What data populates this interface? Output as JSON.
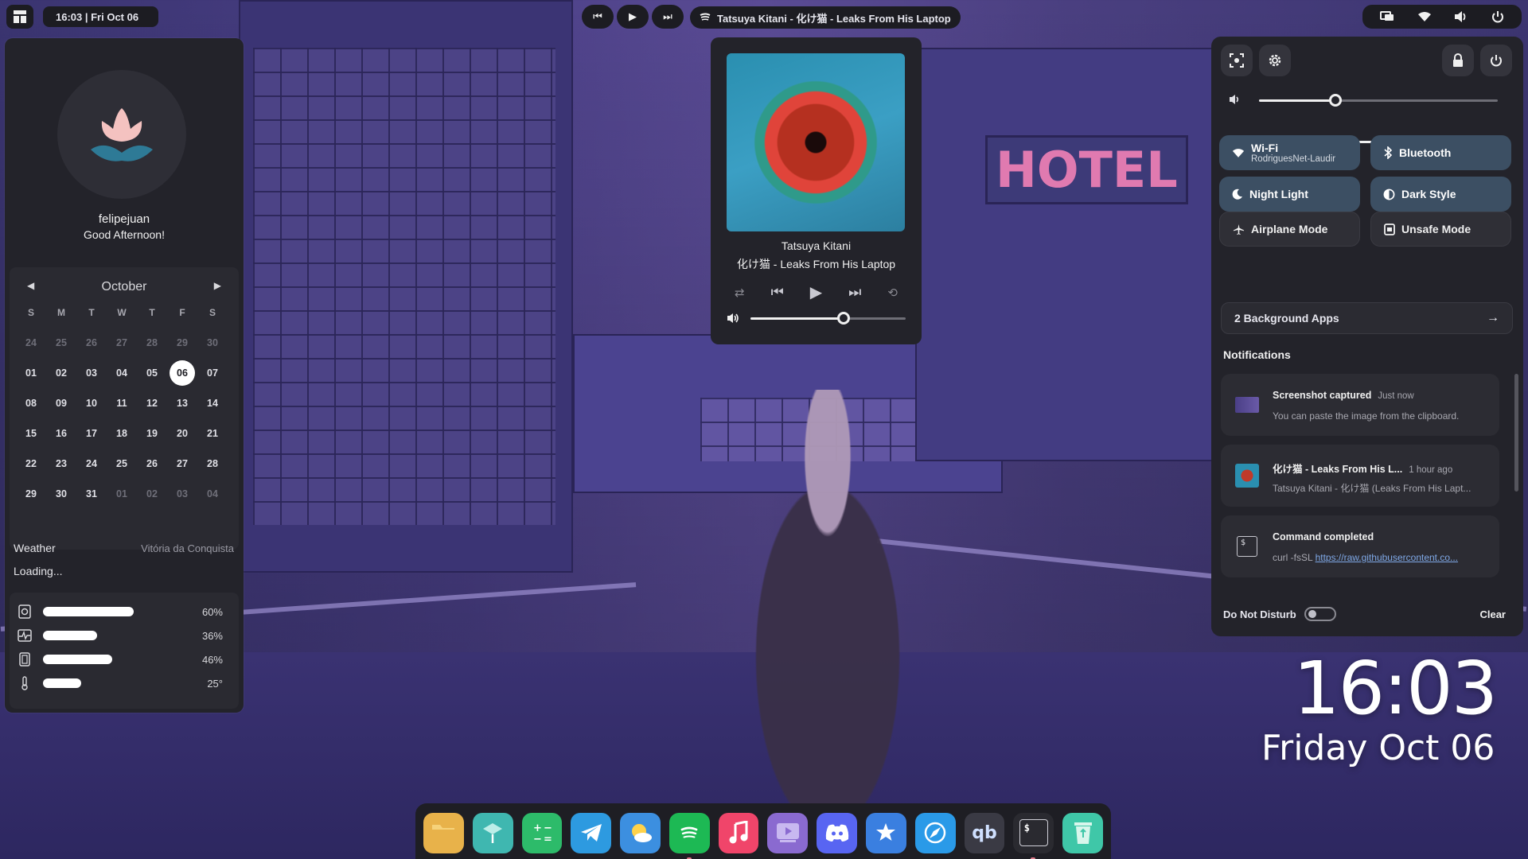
{
  "topbar": {
    "clock": "16:03 | Fri Oct 06",
    "now_playing": "Tatsuya Kitani - 化け猫 - Leaks From His Laptop"
  },
  "dashboard": {
    "username": "felipejuan",
    "greeting": "Good Afternoon!",
    "calendar": {
      "month": "October",
      "weekdays": [
        "S",
        "M",
        "T",
        "W",
        "T",
        "F",
        "S"
      ],
      "days": [
        {
          "d": "24",
          "dim": true
        },
        {
          "d": "25",
          "dim": true
        },
        {
          "d": "26",
          "dim": true
        },
        {
          "d": "27",
          "dim": true
        },
        {
          "d": "28",
          "dim": true
        },
        {
          "d": "29",
          "dim": true
        },
        {
          "d": "30",
          "dim": true
        },
        {
          "d": "01"
        },
        {
          "d": "02"
        },
        {
          "d": "03"
        },
        {
          "d": "04"
        },
        {
          "d": "05"
        },
        {
          "d": "06",
          "today": true
        },
        {
          "d": "07"
        },
        {
          "d": "08"
        },
        {
          "d": "09"
        },
        {
          "d": "10"
        },
        {
          "d": "11"
        },
        {
          "d": "12"
        },
        {
          "d": "13"
        },
        {
          "d": "14"
        },
        {
          "d": "15"
        },
        {
          "d": "16"
        },
        {
          "d": "17"
        },
        {
          "d": "18"
        },
        {
          "d": "19"
        },
        {
          "d": "20"
        },
        {
          "d": "21"
        },
        {
          "d": "22"
        },
        {
          "d": "23"
        },
        {
          "d": "24"
        },
        {
          "d": "25"
        },
        {
          "d": "26"
        },
        {
          "d": "27"
        },
        {
          "d": "28"
        },
        {
          "d": "29"
        },
        {
          "d": "30"
        },
        {
          "d": "31"
        },
        {
          "d": "01",
          "dim": true
        },
        {
          "d": "02",
          "dim": true
        },
        {
          "d": "03",
          "dim": true
        },
        {
          "d": "04",
          "dim": true
        }
      ]
    },
    "weather": {
      "title": "Weather",
      "location": "Vitória da Conquista",
      "status": "Loading..."
    },
    "stats": [
      {
        "icon": "disk-icon",
        "value": 60,
        "label": "60%"
      },
      {
        "icon": "cpu-activity-icon",
        "value": 36,
        "label": "36%"
      },
      {
        "icon": "memory-icon",
        "value": 46,
        "label": "46%"
      },
      {
        "icon": "thermometer-icon",
        "value": 25,
        "label": "25°"
      }
    ]
  },
  "player": {
    "artist": "Tatsuya Kitani",
    "title": "化け猫 - Leaks From His Laptop",
    "volume": 0.6
  },
  "quick_settings": {
    "volume": 0.32,
    "brightness": 0.78,
    "toggles": [
      {
        "label": "Wi-Fi",
        "sub": "RodriguesNet-Laudir",
        "on": true,
        "icon": "wifi-icon"
      },
      {
        "label": "Bluetooth",
        "on": true,
        "icon": "bluetooth-icon"
      },
      {
        "label": "Night Light",
        "on": true,
        "icon": "moon-icon"
      },
      {
        "label": "Dark Style",
        "on": true,
        "icon": "contrast-icon"
      },
      {
        "label": "Airplane Mode",
        "on": false,
        "icon": "airplane-icon"
      },
      {
        "label": "Unsafe Mode",
        "on": false,
        "icon": "unsafe-icon"
      }
    ],
    "background_apps": "2 Background Apps",
    "notifications_title": "Notifications",
    "notifications": [
      {
        "title": "Screenshot captured",
        "time": "Just now",
        "body": "You can paste the image from the clipboard.",
        "icon": "screenshot-thumb-icon"
      },
      {
        "title": "化け猫 - Leaks From His L...",
        "time": "1 hour ago",
        "body": "Tatsuya Kitani - 化け猫 (Leaks From His Lapt...",
        "icon": "album-thumb-icon"
      },
      {
        "title": "Command completed",
        "time": "",
        "body_prefix": "curl -fsSL ",
        "body_link": "https://raw.githubusercontent.co...",
        "icon": "terminal-icon"
      }
    ],
    "dnd_label": "Do Not Disturb",
    "clear_label": "Clear"
  },
  "desktop_clock": {
    "time": "16:03",
    "date": "Friday Oct 06"
  },
  "dock": [
    {
      "name": "files",
      "icon": "folder-icon",
      "color": "#e8b24a",
      "running": false
    },
    {
      "name": "terminal-app",
      "icon": "app-icon",
      "color": "#3fb7b0",
      "running": false
    },
    {
      "name": "calculator",
      "icon": "calculator-icon",
      "color": "#2dbb6a",
      "running": false
    },
    {
      "name": "telegram",
      "icon": "telegram-icon",
      "color": "#2d9ae0",
      "running": false
    },
    {
      "name": "weather",
      "icon": "weather-icon",
      "color": "#3c8fe0",
      "running": false
    },
    {
      "name": "spotify",
      "icon": "spotify-icon",
      "color": "#1db954",
      "running": true
    },
    {
      "name": "music",
      "icon": "music-icon",
      "color": "#f0456a",
      "running": false
    },
    {
      "name": "video",
      "icon": "video-icon",
      "color": "#8a6ad0",
      "running": false
    },
    {
      "name": "discord",
      "icon": "discord-icon",
      "color": "#5865f2",
      "running": false
    },
    {
      "name": "store",
      "icon": "store-icon",
      "color": "#3a7fe0",
      "running": false
    },
    {
      "name": "browser",
      "icon": "browser-icon",
      "color": "#2a9ae8",
      "running": false
    },
    {
      "name": "qbittorrent",
      "icon": "qbittorrent-icon",
      "color": "#3a3a44",
      "text": "qb",
      "running": false
    },
    {
      "name": "console",
      "icon": "console-icon",
      "color": "#2a2a30",
      "text": "$",
      "running": true
    },
    {
      "name": "trash",
      "icon": "trash-icon",
      "color": "#3fc7a8",
      "running": false
    }
  ]
}
